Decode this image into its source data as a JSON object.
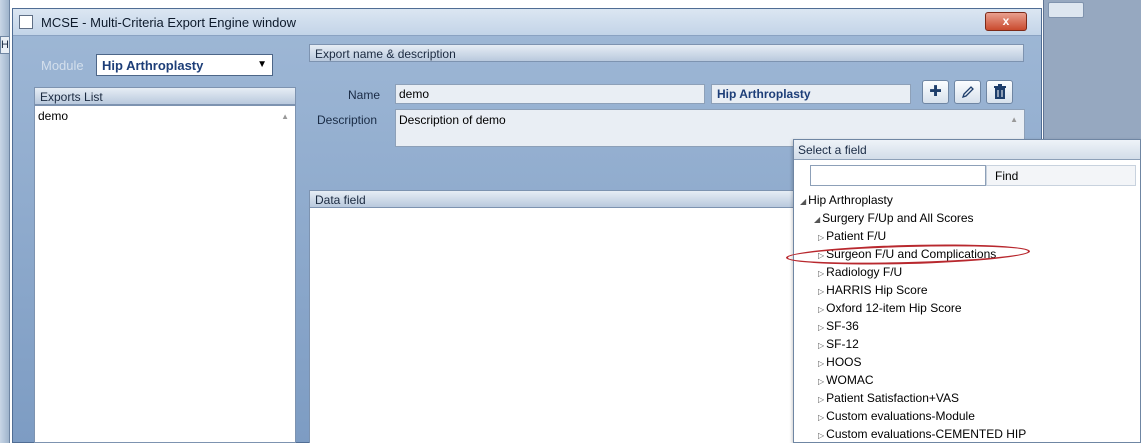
{
  "window": {
    "title": "MCSE - Multi-Criteria Export Engine window",
    "close_symbol": "x",
    "edge_letter": "H"
  },
  "module": {
    "label": "Module",
    "selected": "Hip Arthroplasty"
  },
  "exports": {
    "header": "Exports List",
    "items": [
      "demo"
    ]
  },
  "export_details": {
    "header": "Export name & description",
    "name_label": "Name",
    "name_value": "demo",
    "module_value": "Hip Arthroplasty",
    "description_label": "Description",
    "description_value": "Description of demo"
  },
  "data_field": {
    "header": "Data field"
  },
  "field_picker": {
    "title": "Select a field",
    "find_value": "",
    "find_label": "Find",
    "tree": [
      {
        "label": "Hip Arthroplasty",
        "level": 0,
        "expanded": true
      },
      {
        "label": "Surgery F/Up and All Scores",
        "level": 1,
        "expanded": true
      },
      {
        "label": "Patient F/U",
        "level": 2,
        "expanded": false
      },
      {
        "label": "Surgeon F/U and Complications",
        "level": 2,
        "expanded": false,
        "highlighted": true
      },
      {
        "label": "Radiology F/U",
        "level": 2,
        "expanded": false
      },
      {
        "label": "HARRIS Hip Score",
        "level": 2,
        "expanded": false
      },
      {
        "label": "Oxford 12-item Hip Score",
        "level": 2,
        "expanded": false
      },
      {
        "label": "SF-36",
        "level": 2,
        "expanded": false
      },
      {
        "label": "SF-12",
        "level": 2,
        "expanded": false
      },
      {
        "label": "HOOS",
        "level": 2,
        "expanded": false
      },
      {
        "label": "WOMAC",
        "level": 2,
        "expanded": false
      },
      {
        "label": "Patient Satisfaction+VAS",
        "level": 2,
        "expanded": false
      },
      {
        "label": "Custom evaluations-Module",
        "level": 2,
        "expanded": false
      },
      {
        "label": "Custom evaluations-CEMENTED HIP",
        "level": 2,
        "expanded": false
      }
    ]
  },
  "colors": {
    "accent_text": "#1d3e78",
    "highlight_oval": "#b8282e",
    "close_button": "#c94b2e"
  }
}
